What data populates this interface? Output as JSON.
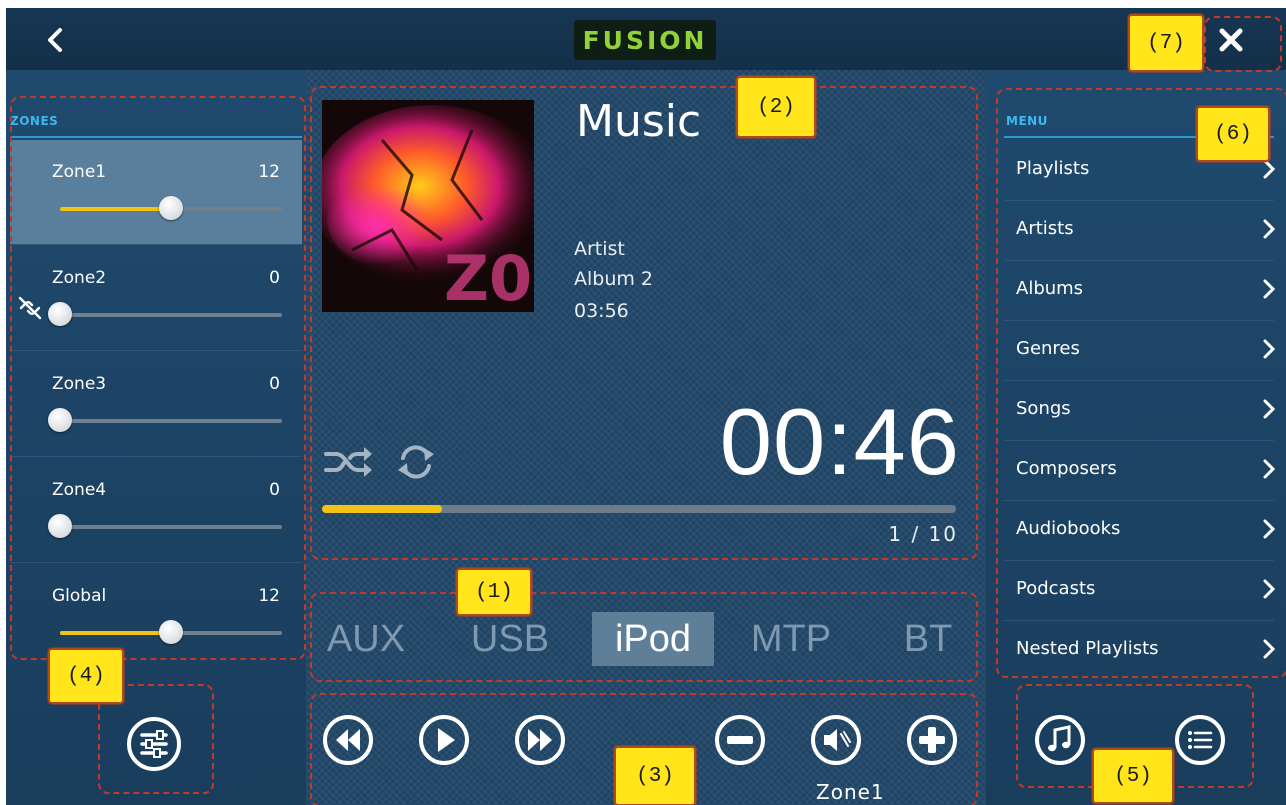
{
  "header": {
    "logo_text": "FUSION",
    "back_icon": "chevron-left-icon",
    "close_icon": "close-icon",
    "logo_color": "#8fd23a"
  },
  "zones_panel": {
    "heading": "ZONES",
    "zones": [
      {
        "name": "Zone1",
        "value": "12",
        "level": 0.5,
        "active": true
      },
      {
        "name": "Zone2",
        "value": "0",
        "level": 0.0,
        "active": false
      },
      {
        "name": "Zone3",
        "value": "0",
        "level": 0.0,
        "active": false
      },
      {
        "name": "Zone4",
        "value": "0",
        "level": 0.0,
        "active": false
      },
      {
        "name": "Global",
        "value": "12",
        "level": 0.5,
        "active": false
      }
    ]
  },
  "now_playing": {
    "title": "Music",
    "artist": "Artist",
    "album": "Album 2",
    "duration": "03:56",
    "elapsed": "00:46",
    "progress": 0.19,
    "track_count": "1 / 10"
  },
  "sources": {
    "items": [
      "AUX",
      "USB",
      "iPod",
      "MTP",
      "BT"
    ],
    "selected": "iPod"
  },
  "controls": {
    "zone_label": "Zone1"
  },
  "menu_panel": {
    "heading": "MENU",
    "items": [
      "Playlists",
      "Artists",
      "Albums",
      "Genres",
      "Songs",
      "Composers",
      "Audiobooks",
      "Podcasts",
      "Nested Playlists"
    ]
  },
  "callouts": {
    "c1": "(1)",
    "c2": "(2)",
    "c3": "(3)",
    "c4": "(4)",
    "c5": "(5)",
    "c6": "(6)",
    "c7": "(7)"
  },
  "colors": {
    "accent": "#f2c312",
    "panel": "#1f4a6e",
    "callout_fill": "#ffe51a",
    "callout_border": "#c0392b"
  }
}
